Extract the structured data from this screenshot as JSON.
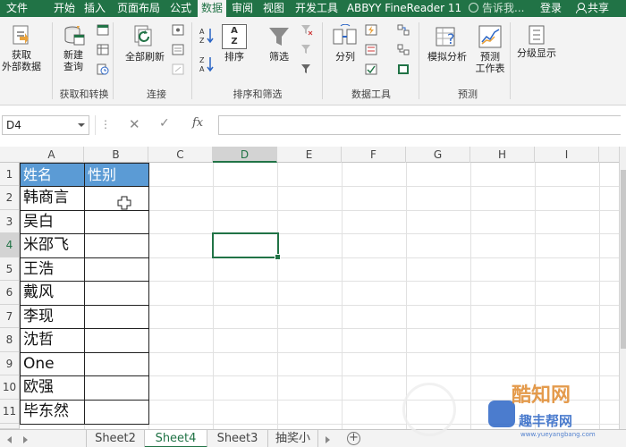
{
  "ribbon_tabs": [
    "文件",
    "开始",
    "插入",
    "页面布局",
    "公式",
    "数据",
    "审阅",
    "视图",
    "开发工具",
    "ABBYY FineReader 11"
  ],
  "active_tab": "数据",
  "tell_me": "告诉我...",
  "login": "登录",
  "share": "共享",
  "ribbon": {
    "get_external_label": "获取\n外部数据",
    "new_query_label": "新建\n查询",
    "refresh_all_label": "全部刷新",
    "sort_label": "排序",
    "filter_label": "筛选",
    "split_label": "分列",
    "whatif_label": "模拟分析",
    "forecast_label": "预测\n工作表",
    "outline_label": "分级显示",
    "az_label": "A\nZ",
    "groups": [
      "获取和转换",
      "连接",
      "排序和筛选",
      "数据工具",
      "预测"
    ]
  },
  "formula_bar": {
    "name_box": "D4",
    "cancel_icon": "✕",
    "enter_icon": "✓",
    "fx_label": "fx",
    "formula": ""
  },
  "columns": [
    "A",
    "B",
    "C",
    "D",
    "E",
    "F",
    "G",
    "H",
    "I"
  ],
  "selected_column": "D",
  "rows": [
    "1",
    "2",
    "3",
    "4",
    "5",
    "6",
    "7",
    "8",
    "9",
    "10",
    "11"
  ],
  "selected_row": "4",
  "header_row": {
    "a": "姓名",
    "b": "性别"
  },
  "names": [
    "韩商言",
    "吴白",
    "米邵飞",
    "王浩",
    "戴风",
    "李现",
    "沈哲",
    "One",
    "欧强",
    "毕东然"
  ],
  "sheets": [
    "Sheet2",
    "Sheet4",
    "Sheet3",
    "抽奖小"
  ],
  "active_sheet": "Sheet4",
  "add_sheet": "+",
  "watermark": {
    "brand": "酷知网",
    "site": "趣丰帮网",
    "url": "www.yueyangbang.com"
  },
  "colors": {
    "accent": "#217346",
    "header_fill": "#5b9bd5"
  }
}
